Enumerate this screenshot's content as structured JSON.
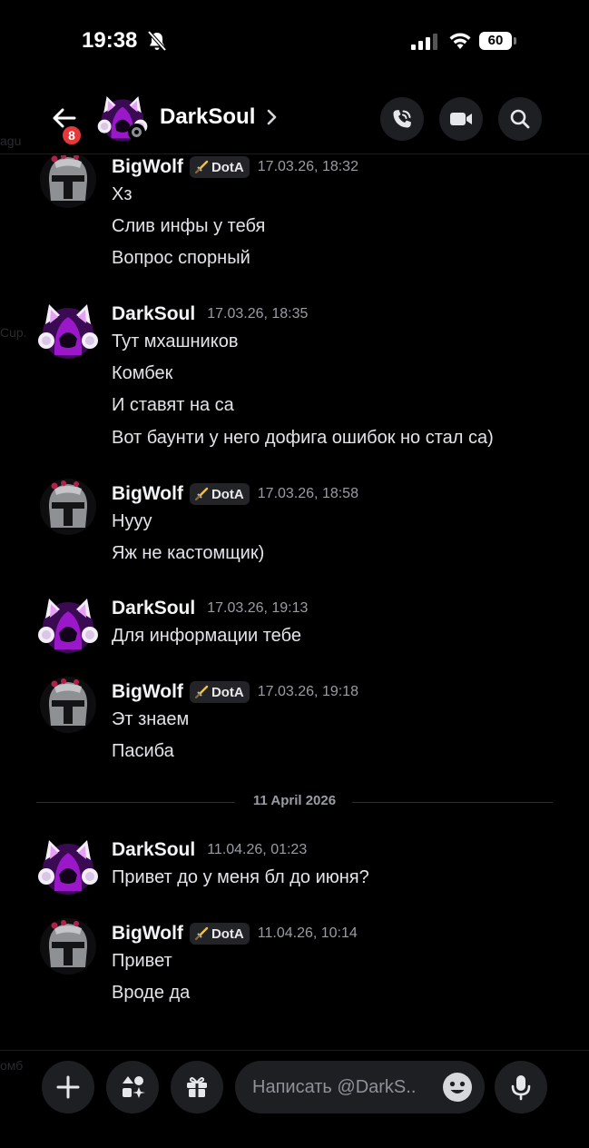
{
  "status_bar": {
    "time": "19:38",
    "battery": "60"
  },
  "header": {
    "unread_badge": "8",
    "channel_name": "DarkSoul"
  },
  "messages": [
    {
      "author": "BigWolf",
      "tag": "DotA",
      "timestamp": "17.03.26, 18:32",
      "lines": [
        "Хз",
        "Слив инфы у тебя",
        "Вопрос спорный"
      ]
    },
    {
      "author": "DarkSoul",
      "timestamp": "17.03.26, 18:35",
      "lines": [
        "Тут мхашников",
        "Комбек",
        "И ставят на са",
        "Вот баунти у него дофига ошибок но стал са)"
      ]
    },
    {
      "author": "BigWolf",
      "tag": "DotA",
      "timestamp": "17.03.26, 18:58",
      "lines": [
        "Нууу",
        "Яж не кастомщик)"
      ]
    },
    {
      "author": "DarkSoul",
      "timestamp": "17.03.26, 19:13",
      "lines": [
        "Для информации тебе"
      ]
    },
    {
      "author": "BigWolf",
      "tag": "DotA",
      "timestamp": "17.03.26, 19:18",
      "lines": [
        "Эт знаем",
        "Пасиба"
      ]
    },
    {
      "author": "DarkSoul",
      "timestamp": "11.04.26, 01:23",
      "lines": [
        "Привет до у меня бл до июня?"
      ]
    },
    {
      "author": "BigWolf",
      "tag": "DotA",
      "timestamp": "11.04.26, 10:14",
      "lines": [
        "Привет",
        "Вроде да"
      ]
    }
  ],
  "date_divider": "11 April 2026",
  "composer": {
    "placeholder": "Написать @DarkS.."
  },
  "background_fragments": [
    "agu",
    "Cup.",
    "омб"
  ],
  "colors": {
    "background": "#000000",
    "surface": "#1e1f22",
    "badge": "#e5383b",
    "avatar_accent": "#b01ee0"
  }
}
